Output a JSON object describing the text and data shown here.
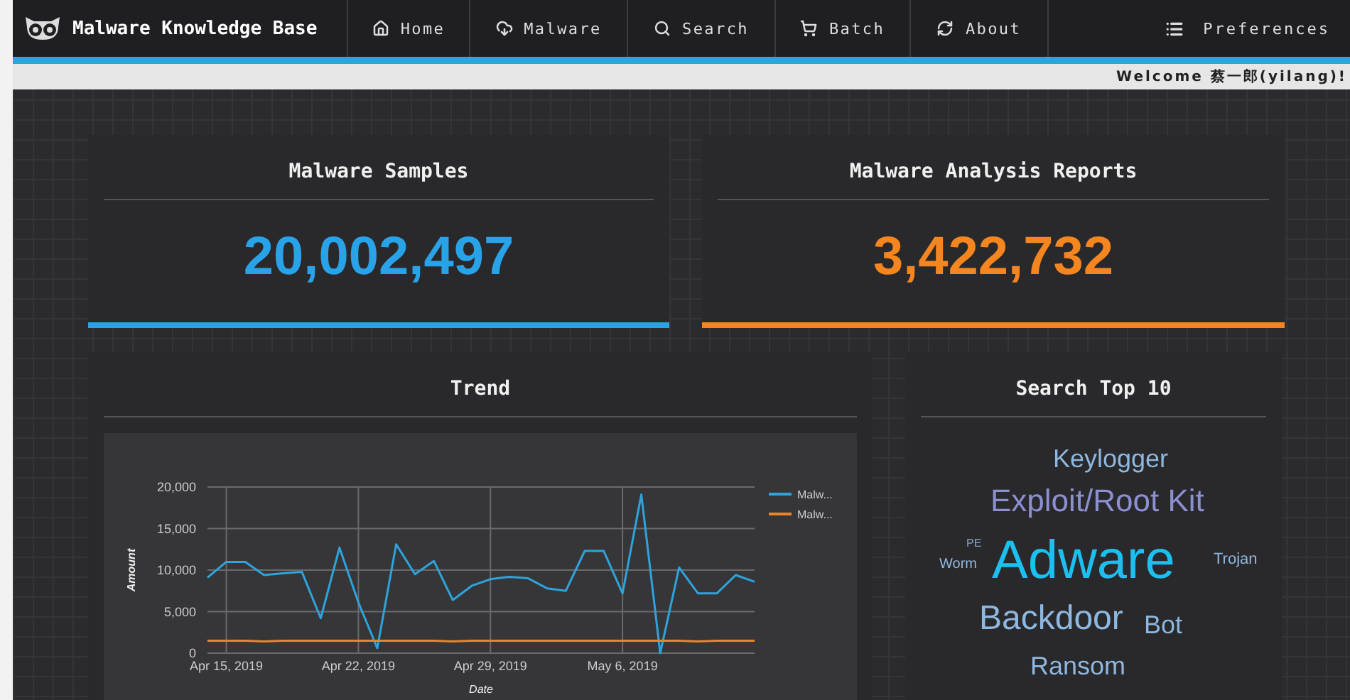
{
  "header": {
    "brand": "Malware Knowledge Base",
    "nav": [
      {
        "label": "Home",
        "kind": "home"
      },
      {
        "label": "Malware",
        "kind": "malware"
      },
      {
        "label": "Search",
        "kind": "search"
      },
      {
        "label": "Batch",
        "kind": "batch"
      },
      {
        "label": "About",
        "kind": "about"
      }
    ],
    "preferences": "Preferences"
  },
  "welcome": "Welcome 蔡一郎(yilang)!",
  "stats": [
    {
      "title": "Malware Samples",
      "value": "20,002,497",
      "color": "#29a3e8"
    },
    {
      "title": "Malware Analysis Reports",
      "value": "3,422,732",
      "color": "#f5861f"
    }
  ],
  "trend": {
    "title": "Trend",
    "chart_data": {
      "type": "line",
      "xlabel": "Date",
      "ylabel": "Amount",
      "grid": true,
      "categories": [
        null,
        "Apr 15, 2019",
        null,
        null,
        null,
        null,
        null,
        null,
        "Apr 22, 2019",
        null,
        null,
        null,
        null,
        null,
        null,
        "Apr 29, 2019",
        null,
        null,
        null,
        null,
        null,
        null,
        "May 6, 2019",
        null,
        null,
        null,
        null,
        null,
        null,
        null
      ],
      "series": [
        {
          "name": "Malw...",
          "color": "#2ea3dc",
          "values": [
            9100,
            11000,
            11000,
            9400,
            9600,
            9800,
            4200,
            12700,
            6100,
            600,
            13100,
            9500,
            11100,
            6400,
            8100,
            8900,
            9200,
            9000,
            7800,
            7500,
            12300,
            12300,
            7200,
            19100,
            0,
            10300,
            7200,
            7200,
            9400,
            8600
          ]
        },
        {
          "name": "Malw...",
          "color": "#e8872a",
          "values": [
            1500,
            1500,
            1500,
            1400,
            1500,
            1500,
            1500,
            1500,
            1500,
            1500,
            1500,
            1500,
            1500,
            1400,
            1500,
            1500,
            1500,
            1500,
            1500,
            1500,
            1500,
            1500,
            1500,
            1500,
            1500,
            1500,
            1400,
            1500,
            1500,
            1500
          ]
        }
      ],
      "ylim": [
        0,
        20000
      ],
      "yticks": [
        {
          "value": 0,
          "label": "0"
        },
        {
          "value": 5000,
          "label": "5,000"
        },
        {
          "value": 10000,
          "label": "10,000"
        },
        {
          "value": 15000,
          "label": "15,000"
        },
        {
          "value": 20000,
          "label": "20,000"
        }
      ]
    }
  },
  "top10": {
    "title": "Search Top 10",
    "words": [
      {
        "text": "Keylogger",
        "color": "#8fb8e0"
      },
      {
        "text": "Exploit/Root Kit",
        "color": "#8c8fd0"
      },
      {
        "text": "PE",
        "color": "#8aa0c0"
      },
      {
        "text": "Worm",
        "color": "#8fb8e0"
      },
      {
        "text": "Adware",
        "color": "#1cc0f0"
      },
      {
        "text": "Trojan",
        "color": "#8fb8e0"
      },
      {
        "text": "Backdoor",
        "color": "#8fb8e0"
      },
      {
        "text": "Bot",
        "color": "#8fb8e0"
      },
      {
        "text": "Ransom",
        "color": "#8fb8e0"
      }
    ]
  }
}
